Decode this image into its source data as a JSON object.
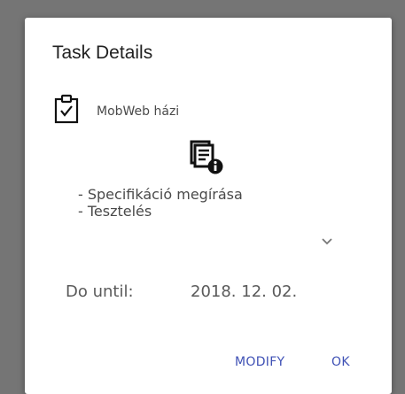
{
  "dialog": {
    "title": "Task Details",
    "task": {
      "icon": "clipboard-check-icon",
      "name": "MobWeb házi"
    },
    "description_icon": "document-info-icon",
    "description_lines": [
      "- Specifikáció megírása",
      "- Tesztelés"
    ],
    "expand_icon": "chevron-down-icon",
    "due": {
      "label": "Do until:",
      "value": "2018. 12. 02."
    },
    "buttons": {
      "modify": "MODIFY",
      "ok": "OK"
    },
    "accent_color": "#3f51b5"
  }
}
